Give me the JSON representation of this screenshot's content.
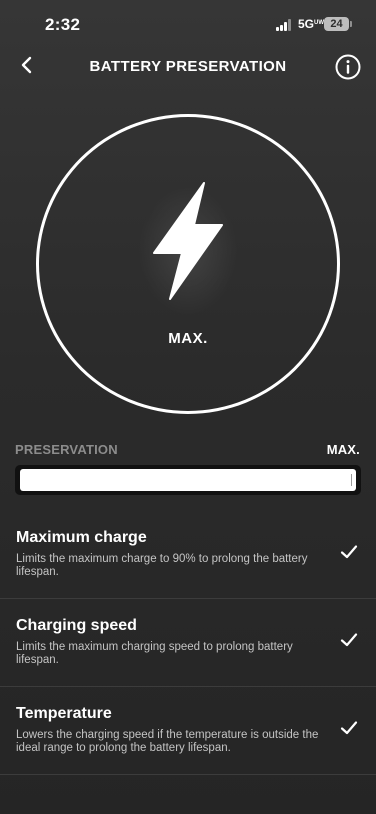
{
  "status_bar": {
    "time": "2:32",
    "network": "5G",
    "network_suffix": "UW",
    "battery": "24"
  },
  "header": {
    "title": "BATTERY PRESERVATION",
    "back_icon": "chevron-left-icon",
    "info_icon": "info-icon"
  },
  "dial": {
    "icon": "lightning-bolt-icon",
    "label": "MAX."
  },
  "slider": {
    "min_label": "PRESERVATION",
    "max_label": "MAX.",
    "value_fraction": 1.0
  },
  "options": [
    {
      "title": "Maximum charge",
      "description": "Limits the maximum charge to 90% to prolong the battery lifespan.",
      "checked": true
    },
    {
      "title": "Charging speed",
      "description": "Limits the maximum charging speed to prolong battery lifespan.",
      "checked": true
    },
    {
      "title": "Temperature",
      "description": "Lowers the charging speed if the temperature is outside the ideal range to prolong the battery lifespan.",
      "checked": true
    }
  ],
  "colors": {
    "background": "#2e2e2e",
    "accent": "#ffffff",
    "muted_label": "#8c8c8c",
    "track": "#111111"
  }
}
